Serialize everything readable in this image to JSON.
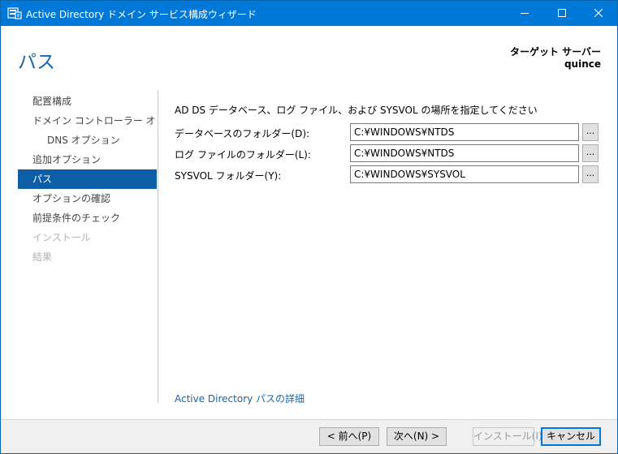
{
  "window": {
    "title": "Active Directory ドメイン サービス構成ウィザード",
    "icons": {
      "app": "server-wizard-icon",
      "minimize": "minimize-icon",
      "maximize": "maximize-icon",
      "close": "close-icon"
    },
    "titlebar_color": "#0078d7"
  },
  "page": {
    "heading": "パス",
    "target_label": "ターゲット サーバー",
    "target_value": "quince",
    "accent_color": "#1a65a6"
  },
  "nav": {
    "items": [
      {
        "label": "配置構成",
        "state": "normal"
      },
      {
        "label": "ドメイン コントローラー オプシ...",
        "state": "normal"
      },
      {
        "label": "DNS オプション",
        "state": "sub"
      },
      {
        "label": "追加オプション",
        "state": "normal"
      },
      {
        "label": "パス",
        "state": "active"
      },
      {
        "label": "オプションの確認",
        "state": "normal"
      },
      {
        "label": "前提条件のチェック",
        "state": "normal"
      },
      {
        "label": "インストール",
        "state": "disabled"
      },
      {
        "label": "結果",
        "state": "disabled"
      }
    ]
  },
  "main": {
    "instruction": "AD DS データベース、ログ ファイル、および SYSVOL の場所を指定してください",
    "fields": [
      {
        "label": "データベースのフォルダー(D):",
        "value": "C:¥WINDOWS¥NTDS",
        "browse": "..."
      },
      {
        "label": "ログ ファイルのフォルダー(L):",
        "value": "C:¥WINDOWS¥NTDS",
        "browse": "..."
      },
      {
        "label": "SYSVOL フォルダー(Y):",
        "value": "C:¥WINDOWS¥SYSVOL",
        "browse": "..."
      }
    ],
    "details_link": "Active Directory パスの詳細"
  },
  "footer": {
    "prev": "< 前へ(P)",
    "next": "次へ(N) >",
    "install": "インストール(I)",
    "cancel": "キャンセル"
  }
}
